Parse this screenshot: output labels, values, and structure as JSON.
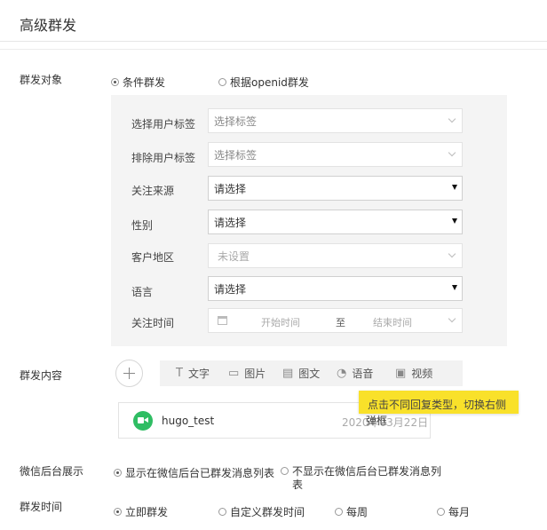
{
  "header": {
    "title": "高级群发"
  },
  "target": {
    "label": "群发对象",
    "options": [
      "条件群发",
      "根据openid群发"
    ],
    "selected": "条件群发"
  },
  "filters": {
    "include_tags": {
      "label": "选择用户标签",
      "placeholder": "选择标签"
    },
    "exclude_tags": {
      "label": "排除用户标签",
      "placeholder": "选择标签"
    },
    "source": {
      "label": "关注来源",
      "value": "请选择"
    },
    "gender": {
      "label": "性别",
      "value": "请选择"
    },
    "region": {
      "label": "客户地区",
      "value": "未设置"
    },
    "language": {
      "label": "语言",
      "value": "请选择"
    },
    "follow_time": {
      "label": "关注时间",
      "start": "开始时间",
      "to": "至",
      "end": "结束时间"
    }
  },
  "content": {
    "label": "群发内容",
    "types": [
      {
        "icon": "text-icon",
        "glyph": "T",
        "label": "文字"
      },
      {
        "icon": "image-icon",
        "glyph": "▭",
        "label": "图片"
      },
      {
        "icon": "article-icon",
        "glyph": "▤",
        "label": "图文"
      },
      {
        "icon": "voice-icon",
        "glyph": "◔",
        "label": "语音"
      },
      {
        "icon": "video-icon",
        "glyph": "▣",
        "label": "视频"
      }
    ],
    "tooltip_line1": "点击不同回复类型，切换右侧",
    "tooltip_line2": "弹框",
    "item": {
      "name": "hugo_test",
      "date": "2020年03月22日"
    }
  },
  "display": {
    "label": "微信后台展示",
    "options": [
      "显示在微信后台已群发消息列表",
      "不显示在微信后台已群发消息列表"
    ],
    "selected": "显示在微信后台已群发消息列表"
  },
  "schedule": {
    "label": "群发时间",
    "options": [
      "立即群发",
      "自定义群发时间",
      "每周",
      "每月"
    ],
    "selected": "立即群发"
  }
}
